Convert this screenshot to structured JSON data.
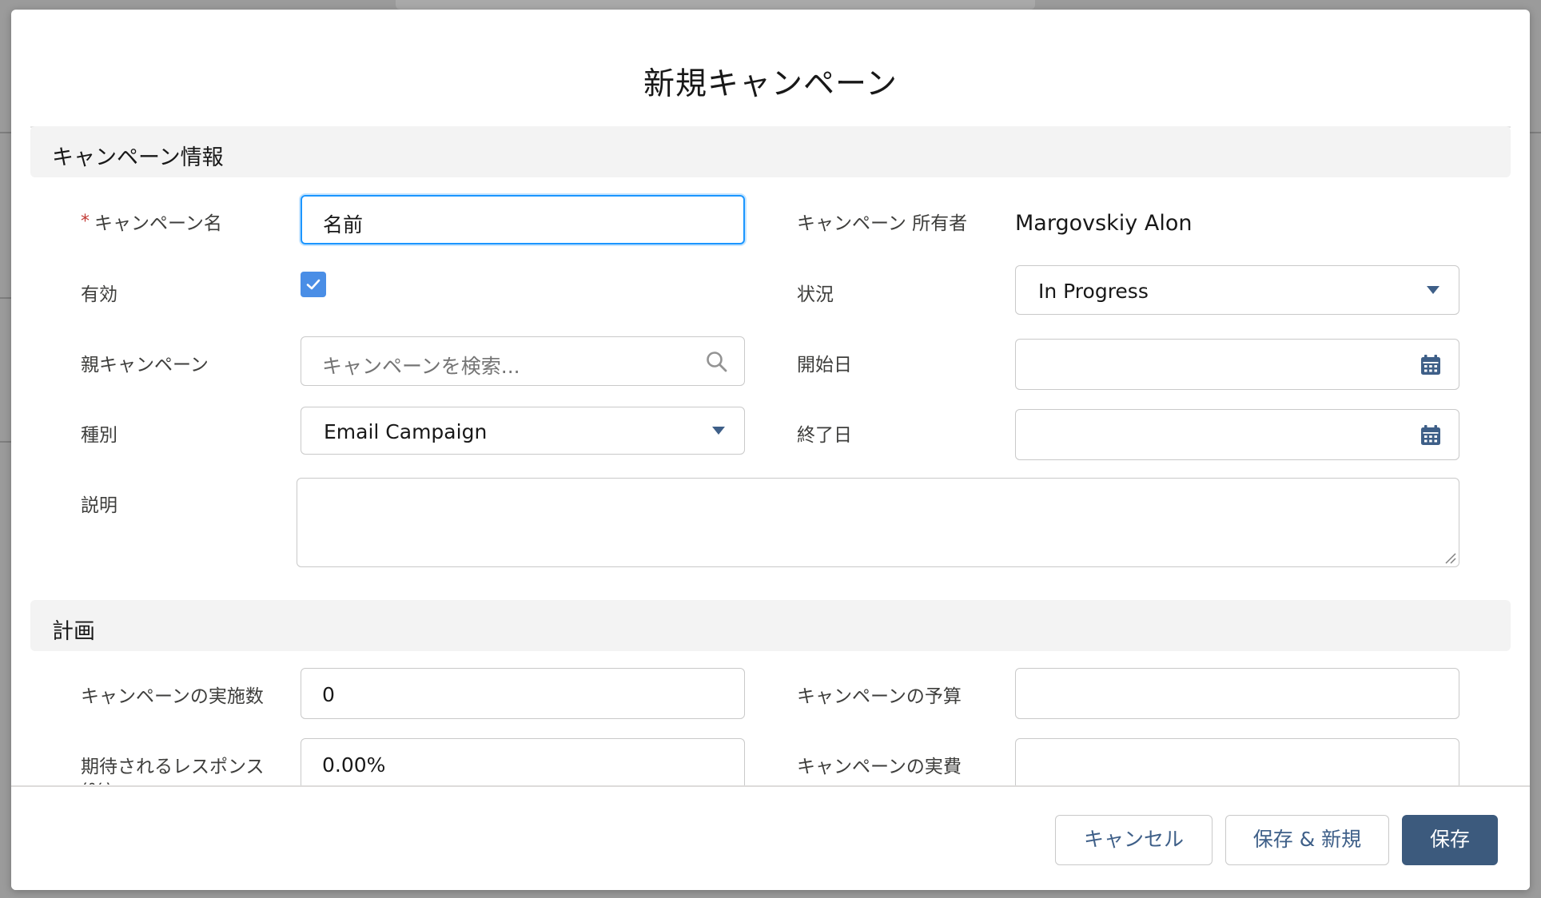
{
  "modal": {
    "title": "新規キャンペーン"
  },
  "sections": {
    "info": "キャンペーン情報",
    "plan": "計画"
  },
  "fields": {
    "name": {
      "label": "キャンペーン名",
      "required_mark": "*",
      "value": "名前"
    },
    "owner": {
      "label": "キャンペーン 所有者",
      "value": "Margovskiy Alon"
    },
    "active": {
      "label": "有効",
      "checked": true
    },
    "status": {
      "label": "状況",
      "value": "In Progress"
    },
    "parent": {
      "label": "親キャンペーン",
      "placeholder": "キャンペーンを検索..."
    },
    "start_date": {
      "label": "開始日",
      "value": ""
    },
    "type": {
      "label": "種別",
      "value": "Email Campaign"
    },
    "end_date": {
      "label": "終了日",
      "value": ""
    },
    "description": {
      "label": "説明",
      "value": ""
    },
    "num_sent": {
      "label": "キャンペーンの実施数",
      "value": "0"
    },
    "budget": {
      "label": "キャンペーンの予算",
      "value": ""
    },
    "expected_response": {
      "label": "期待されるレスポンス (%)",
      "value": "0.00%"
    },
    "actual_cost": {
      "label": "キャンペーンの実費",
      "value": ""
    }
  },
  "footer": {
    "cancel": "キャンセル",
    "save_new": "保存 & 新規",
    "save": "保存"
  },
  "colors": {
    "primary_button": "#3c5a7d",
    "focus_border": "#1b96ff",
    "checkbox": "#4a8ee6",
    "required": "#c23934"
  }
}
